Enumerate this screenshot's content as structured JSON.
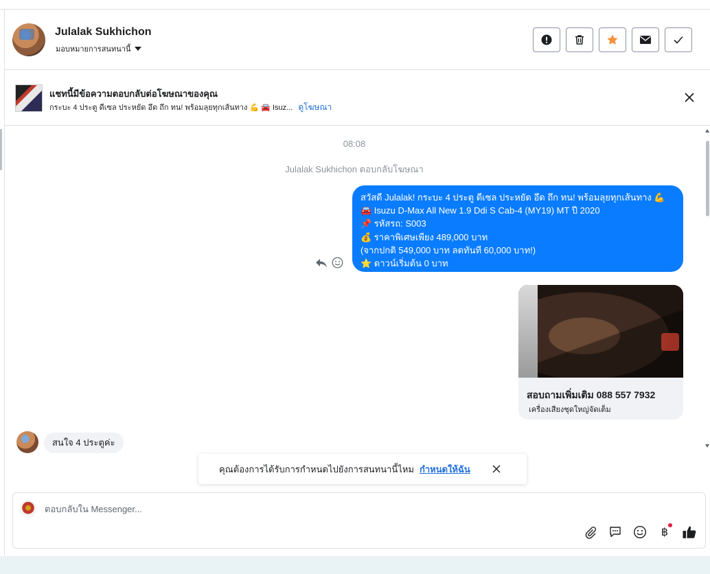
{
  "header": {
    "contact_name": "Julalak Sukhichon",
    "assign_label": "มอบหมายการสนทนานี้",
    "actions": [
      "alert-icon",
      "trash-icon",
      "star-icon",
      "mail-icon",
      "check-icon"
    ],
    "accent_star_color": "#f7923b"
  },
  "ad_banner": {
    "title": "แชทนี้มีข้อความตอบกลับต่อโฆษณาของคุณ",
    "subtitle": "กระบะ 4 ประตู ดีเซล ประหยัด อึด ถึก ทน! พร้อมลุยทุกเส้นทาง 💪 🚘 Isuz...",
    "link": "ดูโฆษณา"
  },
  "messages": {
    "time": "08:08",
    "system_note": "Julalak Sukhichon ตอบกลับโฆษณา",
    "outgoing_lines": [
      "สวัสดี Julalak! กระบะ 4 ประตู ดีเซล ประหยัด อึด ถึก ทน! พร้อมลุยทุกเส้นทาง 💪",
      "🚘 Isuzu D-Max All New 1.9 Ddi S Cab-4 (MY19) MT ปี 2020",
      "📌 รหัสรถ: S003",
      "💰 ราคาพิเศษเพียง 489,000 บาท",
      "(จากปกติ 549,000 บาท ลดทันที 60,000 บาท!)",
      "⭐ ดาวน์เริ่มต้น 0 บาท"
    ],
    "outgoing_color": "#0a7cff",
    "card": {
      "title": "สอบถามเพิ่มเติม 088 557 7932",
      "subtitle": "เครื่องเสียงชุดใหญ่จัดเต็ม"
    },
    "incoming": "สนใจ 4 ประตูค่ะ"
  },
  "notice": {
    "text": "คุณต้องการได้รับการกำหนดไปยังการสนทนานี้ไหม",
    "link": "กำหนดให้ฉัน"
  },
  "composer": {
    "placeholder": "ตอบกลับใน Messenger...",
    "tools": [
      "paperclip-icon",
      "saved-reply-icon",
      "emoji-icon",
      "baht-icon",
      "thumbs-up-icon"
    ],
    "baht_symbol": "฿"
  }
}
